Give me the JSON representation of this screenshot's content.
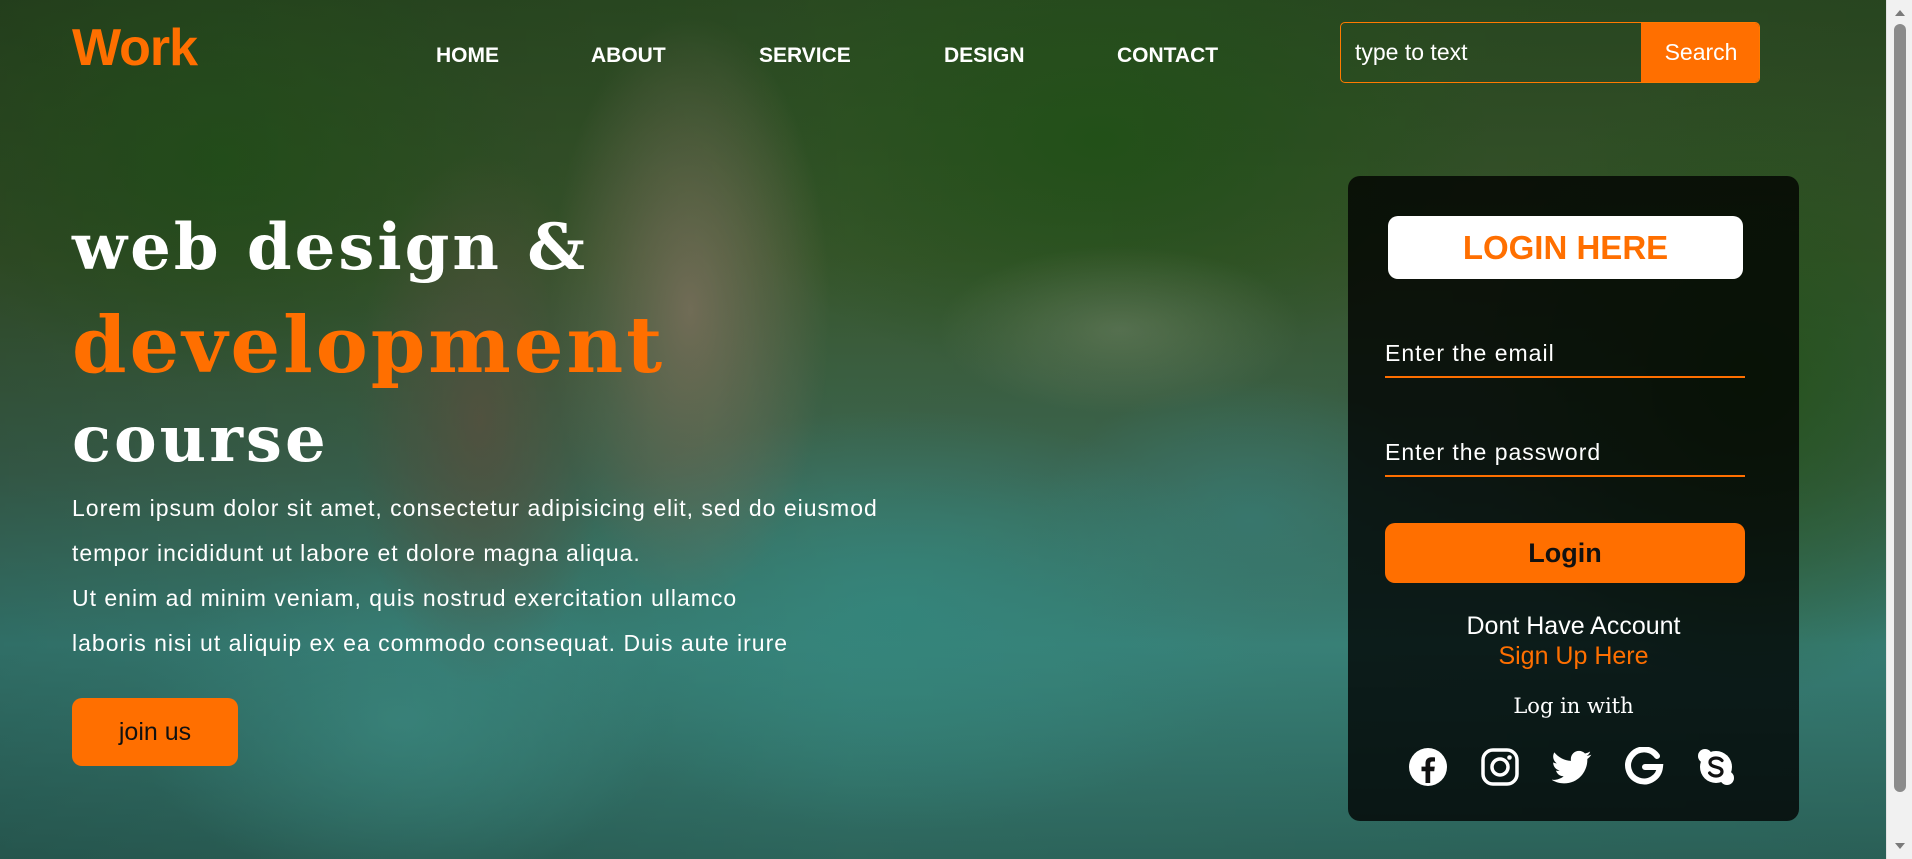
{
  "header": {
    "logo": "Work",
    "nav": [
      "HOME",
      "ABOUT",
      "SERVICE",
      "DESIGN",
      "CONTACT"
    ],
    "search": {
      "placeholder": "type to text",
      "button_label": "Search"
    }
  },
  "hero": {
    "line1": "web design &",
    "line2": "development",
    "line3": "course",
    "paragraph": [
      "Lorem ipsum dolor sit amet, consectetur adipisicing elit, sed do eiusmod",
      "tempor incididunt ut labore et dolore magna aliqua.",
      "Ut enim ad minim veniam, quis nostrud exercitation ullamco",
      "laboris nisi ut aliquip ex ea commodo consequat. Duis aute irure"
    ],
    "button_label": "join us"
  },
  "login": {
    "title": "LOGIN HERE",
    "email_placeholder": "Enter the email",
    "password_placeholder": "Enter the password",
    "button_label": "Login",
    "account_text": "Dont Have Account",
    "signup_label": "Sign Up Here",
    "login_with": "Log in with",
    "social_icons": [
      "facebook-icon",
      "instagram-icon",
      "twitter-icon",
      "google-icon",
      "skype-icon"
    ]
  },
  "colors": {
    "accent": "#ff6f00",
    "card_background": "#000000",
    "text": "#ffffff"
  }
}
